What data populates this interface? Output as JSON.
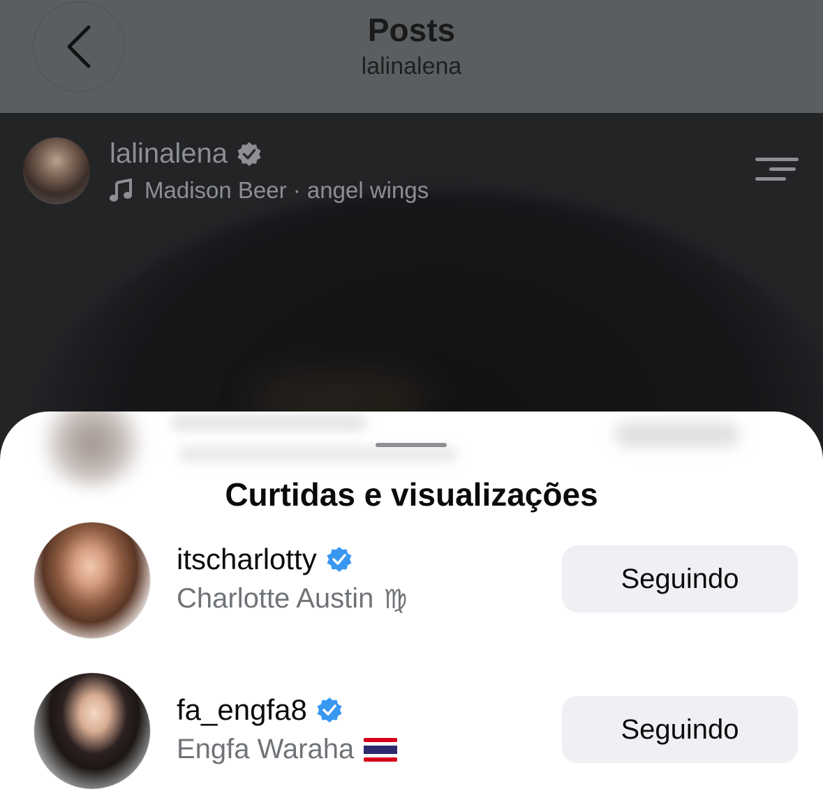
{
  "header": {
    "title": "Posts",
    "subtitle": "lalinalena",
    "back_icon": "chevron-left-icon"
  },
  "post": {
    "username": "lalinalena",
    "verified": true,
    "music_icon": "music-note-icon",
    "music": "Madison Beer · angel wings",
    "menu_icon": "menu-icon"
  },
  "sheet": {
    "title": "Curtidas e visualizações",
    "users": [
      {
        "username": "itscharlotty",
        "verified": true,
        "full_name": "Charlotte Austin",
        "symbol": "♍",
        "button_label": "Seguindo"
      },
      {
        "username": "fa_engfa8",
        "verified": true,
        "full_name": "Engfa Waraha",
        "flag_icon": "thailand-flag-icon",
        "button_label": "Seguindo"
      }
    ]
  },
  "colors": {
    "header_bg": "#5a5e61",
    "verified_blue": "#3897f0",
    "button_bg": "#efeff4"
  }
}
